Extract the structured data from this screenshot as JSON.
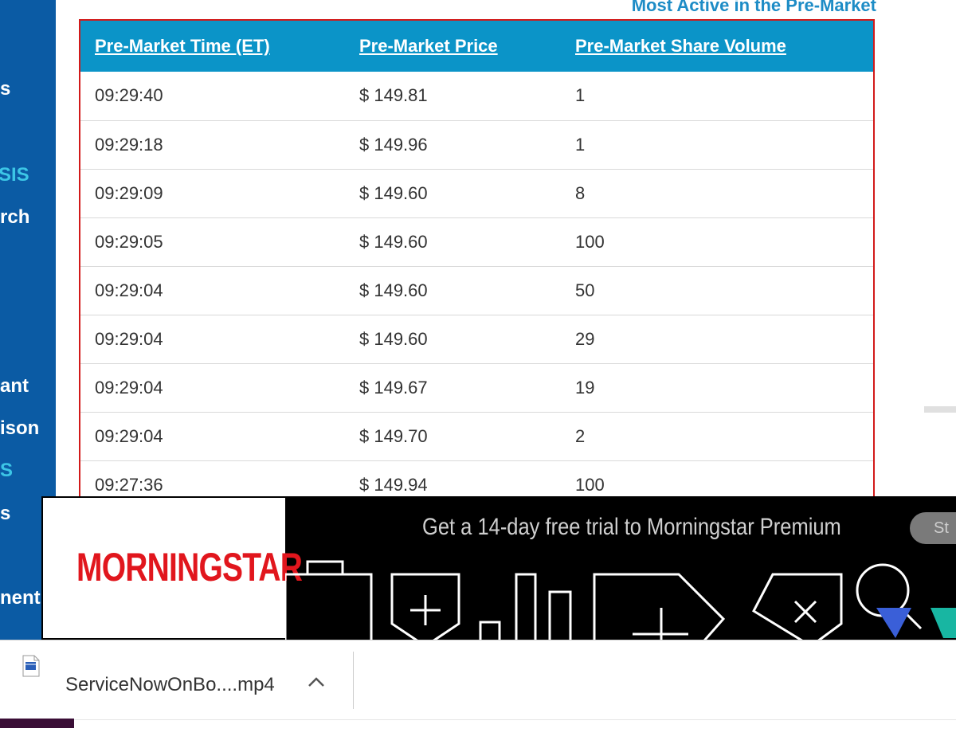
{
  "sidebar": {
    "items": [
      {
        "label": "s",
        "accent": false
      },
      {
        "label": "SIS",
        "accent": true
      },
      {
        "label": "rch",
        "accent": false
      },
      {
        "label": "ant",
        "accent": false
      },
      {
        "label": "ison",
        "accent": false
      },
      {
        "label": "S",
        "accent": true
      },
      {
        "label": "s",
        "accent": false
      },
      {
        "label": "nent",
        "accent": false
      }
    ]
  },
  "section_title": "Most Active in the Pre-Market",
  "table": {
    "headers": [
      "Pre-Market Time (ET)",
      "Pre-Market Price",
      "Pre-Market Share Volume"
    ],
    "rows": [
      [
        "09:29:40",
        "$ 149.81",
        "1"
      ],
      [
        "09:29:18",
        "$ 149.96",
        "1"
      ],
      [
        "09:29:09",
        "$ 149.60",
        "8"
      ],
      [
        "09:29:05",
        "$ 149.60",
        "100"
      ],
      [
        "09:29:04",
        "$ 149.60",
        "50"
      ],
      [
        "09:29:04",
        "$ 149.60",
        "29"
      ],
      [
        "09:29:04",
        "$ 149.67",
        "19"
      ],
      [
        "09:29:04",
        "$ 149.70",
        "2"
      ],
      [
        "09:27:36",
        "$ 149.94",
        "100"
      ]
    ]
  },
  "ad": {
    "logo": "MORNINGSTAR",
    "text": "Get a 14-day free trial to Morningstar Premium",
    "button": "St"
  },
  "download_bar": {
    "file_name": "ServiceNowOnBo....mp4",
    "chevron": "^"
  },
  "colors": {
    "sidebar": "#0b5ba4",
    "accent": "#3cc6e6",
    "header": "#0b94c8",
    "title": "#1d8cc6",
    "border": "#d21a1a",
    "logo": "#e1161d"
  },
  "icons": [
    "video-file-icon",
    "chevron-up-icon"
  ]
}
